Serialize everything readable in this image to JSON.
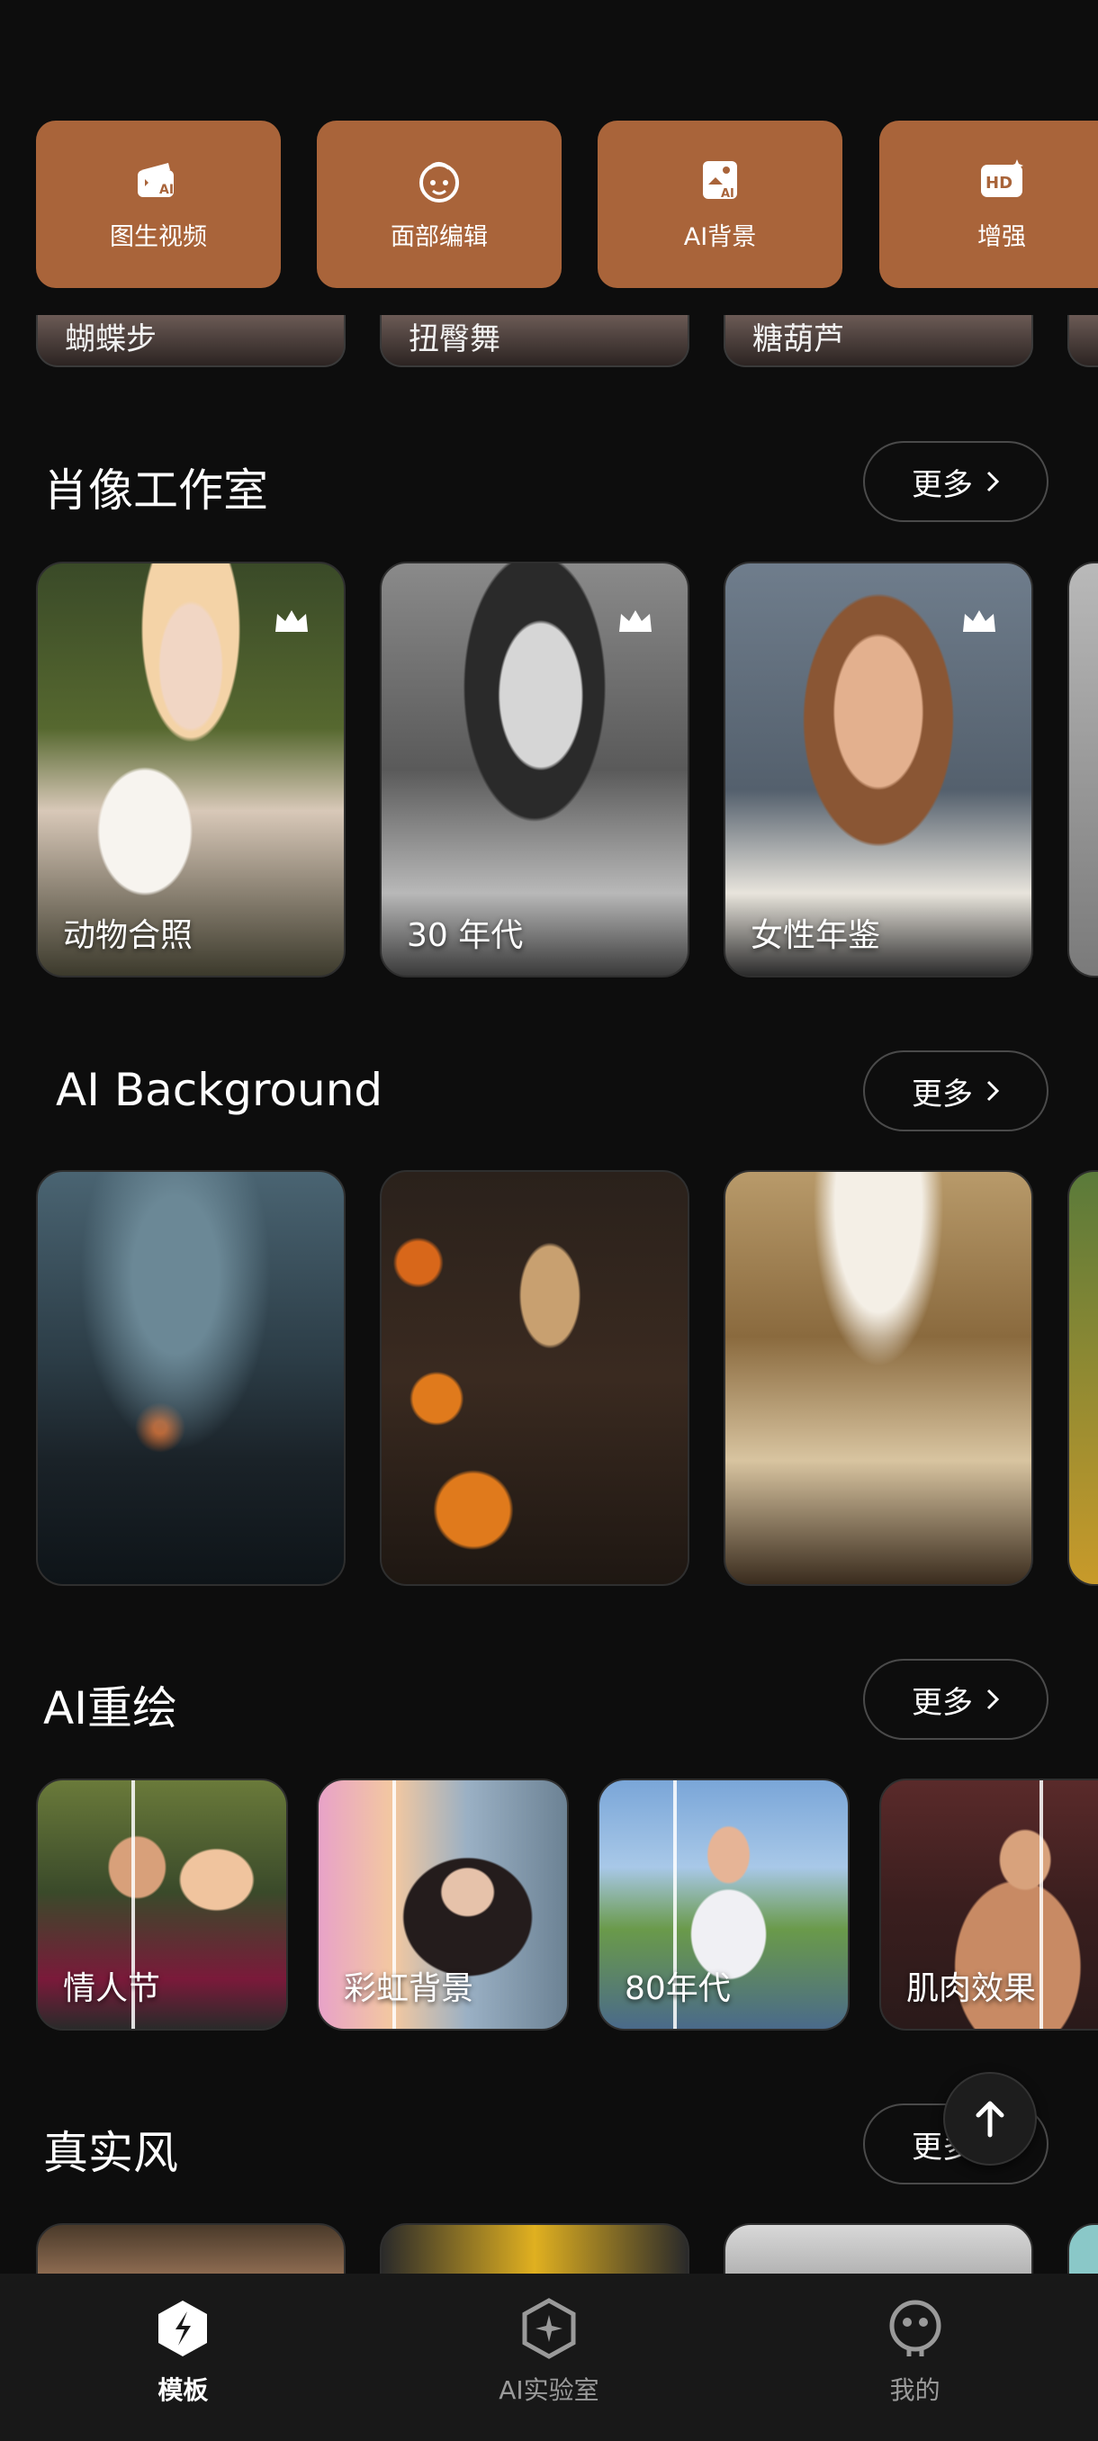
{
  "tools": [
    {
      "label": "图生视频",
      "icon": "image-to-video-icon"
    },
    {
      "label": "面部编辑",
      "icon": "face-edit-icon"
    },
    {
      "label": "AI背景",
      "icon": "ai-background-icon"
    },
    {
      "label": "增强",
      "icon": "hd-enhance-icon"
    }
  ],
  "prev_row": [
    "蝴蝶步",
    "扭臀舞",
    "糖葫芦"
  ],
  "sections": {
    "portrait": {
      "title": "肖像工作室",
      "more": "更多",
      "cards": [
        "动物合照",
        "30 年代",
        "女性年鉴"
      ]
    },
    "ai_background": {
      "title": "AI Background",
      "more": "更多"
    },
    "repaint": {
      "title": "AI重绘",
      "more": "更多",
      "cards": [
        "情人节",
        "彩虹背景",
        "80年代",
        "肌肉效果"
      ]
    },
    "realistic": {
      "title": "真实风",
      "more": "更多"
    }
  },
  "nav": [
    {
      "label": "模板",
      "icon": "template-icon",
      "active": true
    },
    {
      "label": "AI实验室",
      "icon": "ai-lab-icon",
      "active": false
    },
    {
      "label": "我的",
      "icon": "profile-icon",
      "active": false
    }
  ],
  "colors": {
    "tile": "#a9643a",
    "background": "#0d0d0d"
  }
}
